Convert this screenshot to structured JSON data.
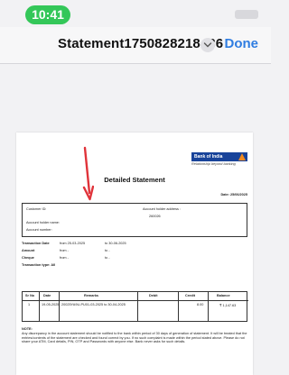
{
  "status_bar": {
    "time": "10:41"
  },
  "nav": {
    "title": "Statement1750828218436",
    "done_label": "Done"
  },
  "statement": {
    "bank_name": "Bank of India",
    "bank_tagline": "Relationship beyond banking",
    "title": "Detailed Statement",
    "date_label": "Date: 25/06/2025",
    "customer_id_label": "Customer ID:",
    "account_holder_address_label": "Account holder address :",
    "pin": "260026",
    "account_holder_name_label": "Account holder name:",
    "account_number_label": "Account number:",
    "transaction_date_label": "Transaction Date",
    "transaction_date_from": "from 25-03-2025",
    "transaction_date_to": "to 30-06-2025",
    "amount_label": "Amount",
    "amount_from": "from -",
    "amount_to": "to -",
    "cheque_label": "Cheque",
    "cheque_from": "from -",
    "cheque_to": "to -",
    "transaction_type_label": "Transaction type: All",
    "columns": [
      "Sr No",
      "Date",
      "Remarks",
      "Debit",
      "Credit",
      "Balance"
    ],
    "rows": [
      {
        "sr_no": "1",
        "date": "19-05-2025",
        "remarks": "20025YA9U-PU01-03-2025 to 30-04-2025",
        "debit": "",
        "credit": "8.00",
        "balance": "₹ 1,147.63"
      }
    ],
    "note_heading": "NOTE:",
    "note_text": "Any discrepancy in the account statement should be notified to the bank within period of 30 days of generation of statement. It will be treated that the entries/contents of the statement are checked and found correct by you. If no such complaint is made within the period stated above. Please do not share your ATM, Card details, PIN, OTP and Passwords with anyone else. Bank never asks for such details."
  },
  "colors": {
    "accent": "#2f7de1",
    "status_pill": "#34c759",
    "annotation_arrow": "#e0333a",
    "bank_blue": "#18439a",
    "bank_orange": "#f08a20"
  }
}
